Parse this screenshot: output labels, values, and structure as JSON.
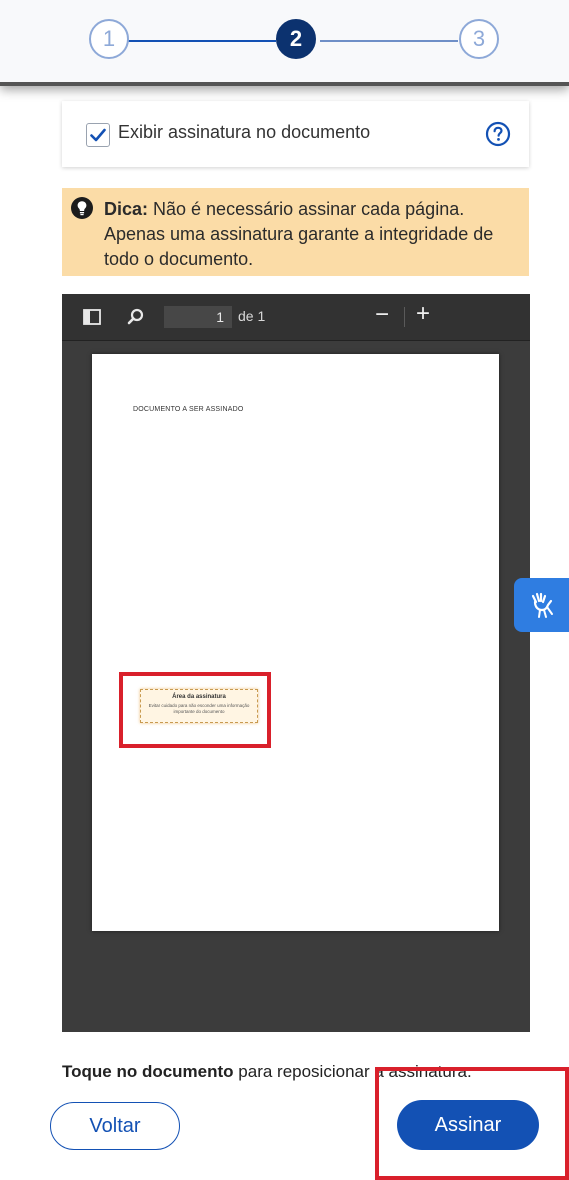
{
  "stepper": {
    "steps": [
      {
        "label": "1",
        "state": "done"
      },
      {
        "label": "2",
        "state": "current"
      },
      {
        "label": "3",
        "state": "pending"
      }
    ]
  },
  "options": {
    "show_signature_label": "Exibir assinatura no documento",
    "show_signature_checked": true,
    "help_icon": "question-circle-icon"
  },
  "tip": {
    "title": "Dica:",
    "text": " Não é necessário assinar cada página. Apenas uma assinatura garante a integridade de todo o documento.",
    "icon": "lightbulb-icon"
  },
  "viewer": {
    "current_page": "1",
    "page_of": "de 1",
    "zoom_out": "−",
    "zoom_in": "+",
    "document_title": "DOCUMENTO A SER ASSINADO",
    "signature_area_title": "Área da assinatura",
    "signature_area_desc": "Evitar cuidado para não esconder uma informação importante do documento"
  },
  "instruction": {
    "bold": "Toque no documento",
    "rest": " para reposicionar a assinatura."
  },
  "buttons": {
    "back": "Voltar",
    "sign": "Assinar"
  },
  "colors": {
    "primary": "#1351b4",
    "step_current": "#0c326f",
    "tip_bg": "#fbdca7",
    "highlight": "#d9202b"
  }
}
